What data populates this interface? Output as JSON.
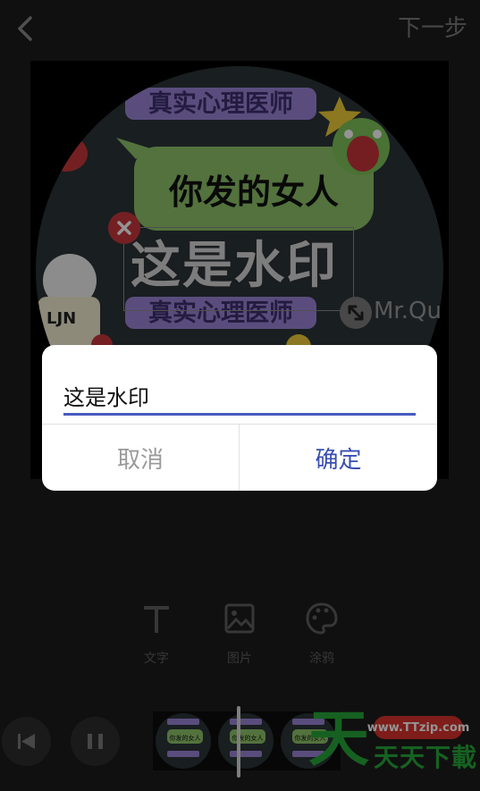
{
  "header": {
    "back_icon": "chevron-left-icon",
    "next_label": "下一步"
  },
  "canvas": {
    "sticker_top_text": "真实心理医师",
    "sticker_bubble_text": "你发的女人",
    "sticker_bottom_text": "真实心理医师",
    "shirt_text": "LJN",
    "signature_text": "Mr.Qu",
    "watermark_text": "这是水印"
  },
  "dialog": {
    "input_value": "这是水印",
    "cancel_label": "取消",
    "confirm_label": "确定"
  },
  "tools": [
    {
      "label": "文字",
      "icon": "text-icon"
    },
    {
      "label": "图片",
      "icon": "image-icon"
    },
    {
      "label": "涂鸦",
      "icon": "palette-icon"
    }
  ],
  "player": {
    "prev_icon": "skip-previous-icon",
    "pause_icon": "pause-icon"
  },
  "timeline_frame_text": "你发的女人",
  "site_logo": {
    "char": "天",
    "url": "www.TTzip.com",
    "name": "天天下載"
  },
  "colors": {
    "accent": "#3a4eb0",
    "underline": "#4a5ac0",
    "close_red": "#c9383d",
    "logo_green": "#27a83a",
    "logo_red": "#d9332b"
  }
}
